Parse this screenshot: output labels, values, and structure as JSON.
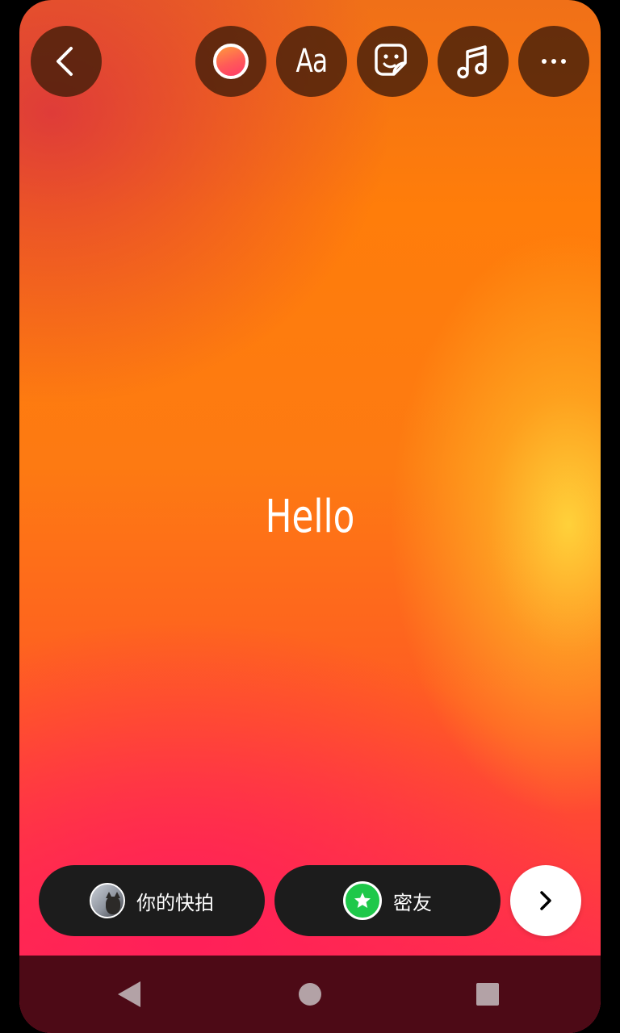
{
  "toolbar": {
    "back_icon": "chevron-left-icon",
    "color_icon": "color-swatch-icon",
    "text_tool_label": "Aa",
    "sticker_icon": "sticker-icon",
    "music_icon": "music-note-icon",
    "more_icon": "more-horizontal-icon"
  },
  "canvas": {
    "text": "Hello",
    "background_colors": [
      "#ff7d0a",
      "#ffd63c",
      "#ff2458"
    ]
  },
  "share": {
    "your_story_label": "你的快拍",
    "close_friends_label": "密友",
    "close_friends_color": "#1ec84a",
    "next_icon": "chevron-right-icon"
  },
  "system_nav": {
    "back_icon": "nav-back-icon",
    "home_icon": "nav-home-icon",
    "recents_icon": "nav-recents-icon"
  }
}
